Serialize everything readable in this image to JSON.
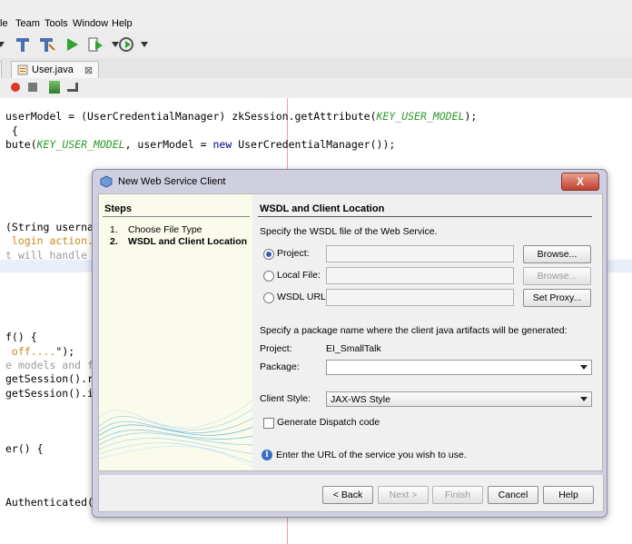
{
  "menu": [
    "le",
    "Team",
    "Tools",
    "Window",
    "Help"
  ],
  "toolbar": {
    "icons": [
      "hammer-icon",
      "clean-build-icon",
      "run-icon",
      "debug-icon",
      "profile-icon"
    ]
  },
  "tab": {
    "label": "User.java",
    "close": "⊠"
  },
  "code_lines": [
    {
      "parts": [
        {
          "t": "userModel = (UserCredentialManager) zkSession.getAttribute(",
          "c": ""
        },
        {
          "t": "KEY_USER_MODEL",
          "c": "g"
        },
        {
          "t": ");",
          "c": ""
        }
      ]
    },
    {
      "parts": [
        {
          "t": " {",
          "c": ""
        }
      ]
    },
    {
      "parts": [
        {
          "t": "bute(",
          "c": ""
        },
        {
          "t": "KEY_USER_MODEL",
          "c": "g"
        },
        {
          "t": ", userModel = ",
          "c": ""
        },
        {
          "t": "new",
          "c": "k"
        },
        {
          "t": " UserCredentialManager());",
          "c": ""
        }
      ]
    },
    {
      "parts": [
        {
          "t": "(String usernar",
          "c": ""
        }
      ]
    },
    {
      "parts": [
        {
          "t": " login action.",
          "c": "o"
        }
      ]
    },
    {
      "parts": [
        {
          "t": "t will handle t",
          "c": "c"
        }
      ]
    },
    {
      "parts": [
        {
          "t": "f() {",
          "c": ""
        }
      ]
    },
    {
      "parts": [
        {
          "t": " off....\");",
          "c": ""
        }
      ]
    },
    {
      "parts": [
        {
          "t": "e models and fo",
          "c": "c"
        }
      ]
    },
    {
      "parts": [
        {
          "t": "getSession().re",
          "c": ""
        }
      ]
    },
    {
      "parts": [
        {
          "t": "getSession().in",
          "c": ""
        }
      ]
    },
    {
      "parts": [
        {
          "t": "er() {",
          "c": ""
        }
      ]
    },
    {
      "parts": [
        {
          "t": "Authenticated()",
          "c": ""
        }
      ]
    }
  ],
  "dialog": {
    "title": "New Web Service Client",
    "close": "X",
    "steps_heading": "Steps",
    "steps": [
      {
        "num": "1.",
        "label": "Choose File Type",
        "current": false
      },
      {
        "num": "2.",
        "label": "WSDL and Client Location",
        "current": true
      }
    ],
    "section_title": "WSDL and Client Location",
    "spec_text": "Specify the WSDL file of the Web Service.",
    "project_label": "Project:",
    "local_file_label": "Local File:",
    "wsdl_url_label": "WSDL URL:",
    "browse_label": "Browse...",
    "browse2_label": "Browse...",
    "set_proxy_label": "Set Proxy...",
    "package_spec_text": "Specify a package name where the client java artifacts will be generated:",
    "project_info_label": "Project:",
    "project_info_value": "EI_SmallTalk",
    "package_label": "Package:",
    "package_value": "",
    "client_style_label": "Client Style:",
    "client_style_value": "JAX-WS Style",
    "generate_dispatch_label": "Generate Dispatch code",
    "info_message": "Enter the URL of the service you wish to use.",
    "buttons": {
      "back": "< Back",
      "next": "Next >",
      "finish": "Finish",
      "cancel": "Cancel",
      "help": "Help"
    }
  }
}
